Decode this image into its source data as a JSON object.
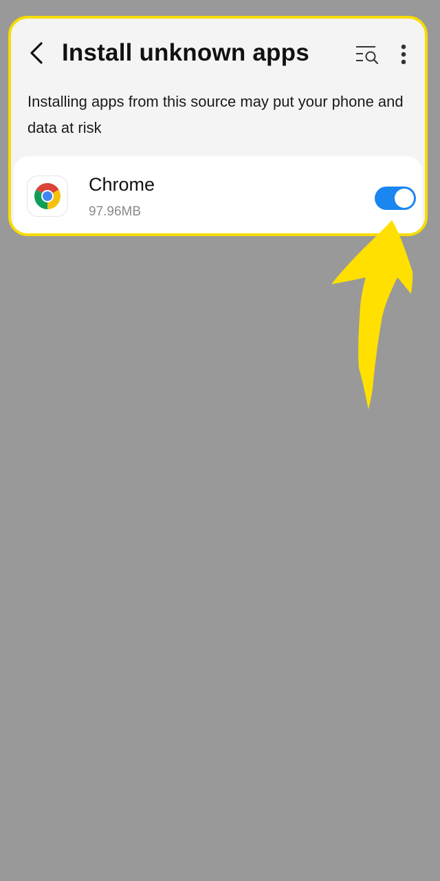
{
  "header": {
    "title": "Install unknown apps",
    "back_icon": "chevron-left-icon",
    "search_icon": "list-search-icon",
    "more_icon": "more-vertical-icon"
  },
  "description": "Installing apps from this source may put your phone and data at risk",
  "apps": [
    {
      "name": "Chrome",
      "size": "97.96MB",
      "icon": "chrome-icon",
      "allowed": true
    }
  ],
  "colors": {
    "background": "#999999",
    "panel": "#f4f4f4",
    "highlight": "#f7dc00",
    "toggle_on": "#1a86f0"
  }
}
